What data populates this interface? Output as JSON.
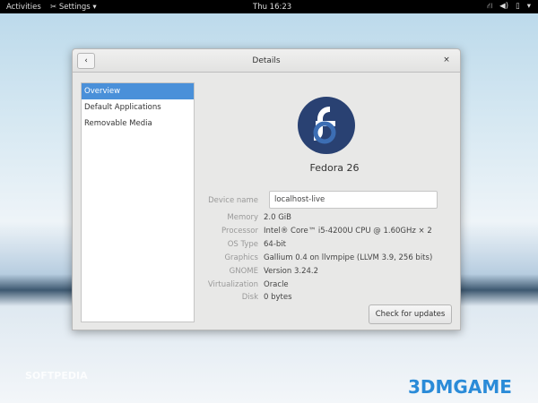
{
  "topbar": {
    "activities": "Activities",
    "app_menu": "Settings ▾",
    "clock": "Thu 16:23",
    "status_icons": [
      "network-icon",
      "volume-icon",
      "battery-icon",
      "chevron-down-icon"
    ]
  },
  "window": {
    "title": "Details",
    "back": "‹",
    "close": "×"
  },
  "sidebar": {
    "items": [
      {
        "label": "Overview",
        "selected": true
      },
      {
        "label": "Default Applications"
      },
      {
        "label": "Removable Media"
      }
    ]
  },
  "details": {
    "os_name": "Fedora 26",
    "logo_letter": "f",
    "device_name_label": "Device name",
    "device_name": "localhost-live",
    "rows": [
      {
        "k": "Memory",
        "v": "2.0 GiB"
      },
      {
        "k": "Processor",
        "v": "Intel® Core™ i5-4200U CPU @ 1.60GHz × 2"
      },
      {
        "k": "OS Type",
        "v": "64-bit"
      },
      {
        "k": "Graphics",
        "v": "Gallium 0.4 on llvmpipe (LLVM 3.9, 256 bits)"
      },
      {
        "k": "GNOME",
        "v": "Version 3.24.2"
      },
      {
        "k": "Virtualization",
        "v": "Oracle"
      },
      {
        "k": "Disk",
        "v": "0 bytes"
      }
    ],
    "check_updates": "Check for updates"
  },
  "watermarks": {
    "softpedia": "SOFTPEDIA",
    "brand": "3DMGAME"
  }
}
